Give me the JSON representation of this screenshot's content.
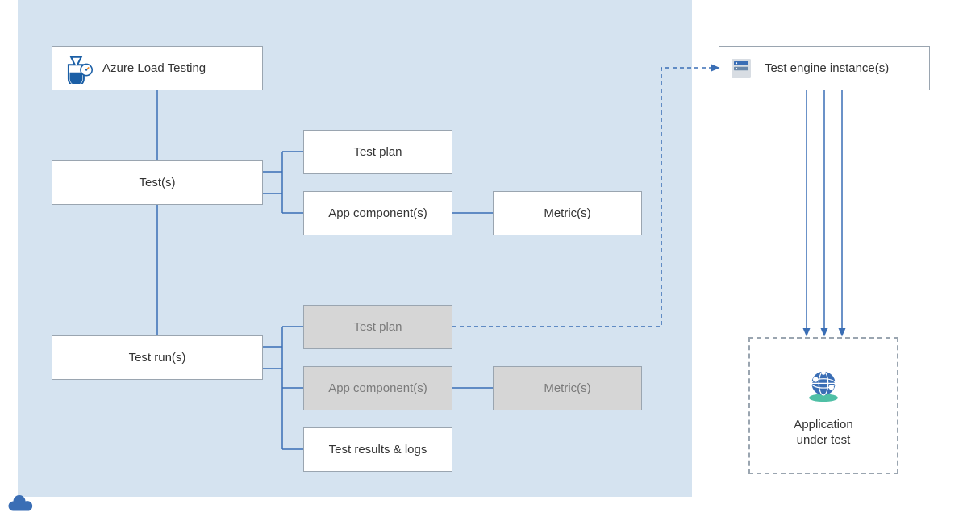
{
  "nodes": {
    "azure_load_testing": "Azure Load Testing",
    "tests": "Test(s)",
    "test_plan": "Test plan",
    "app_components": "App component(s)",
    "metrics": "Metric(s)",
    "test_runs": "Test run(s)",
    "test_plan_copy": "Test plan",
    "app_components_copy": "App component(s)",
    "metrics_copy": "Metric(s)",
    "test_results_logs": "Test results & logs",
    "test_engine": "Test engine instance(s)",
    "application_under_test_l1": "Application",
    "application_under_test_l2": "under test"
  },
  "colors": {
    "region_blue": "#d5e3f0",
    "connector_blue": "#3a6eb5",
    "box_border": "#9aa5b0"
  }
}
